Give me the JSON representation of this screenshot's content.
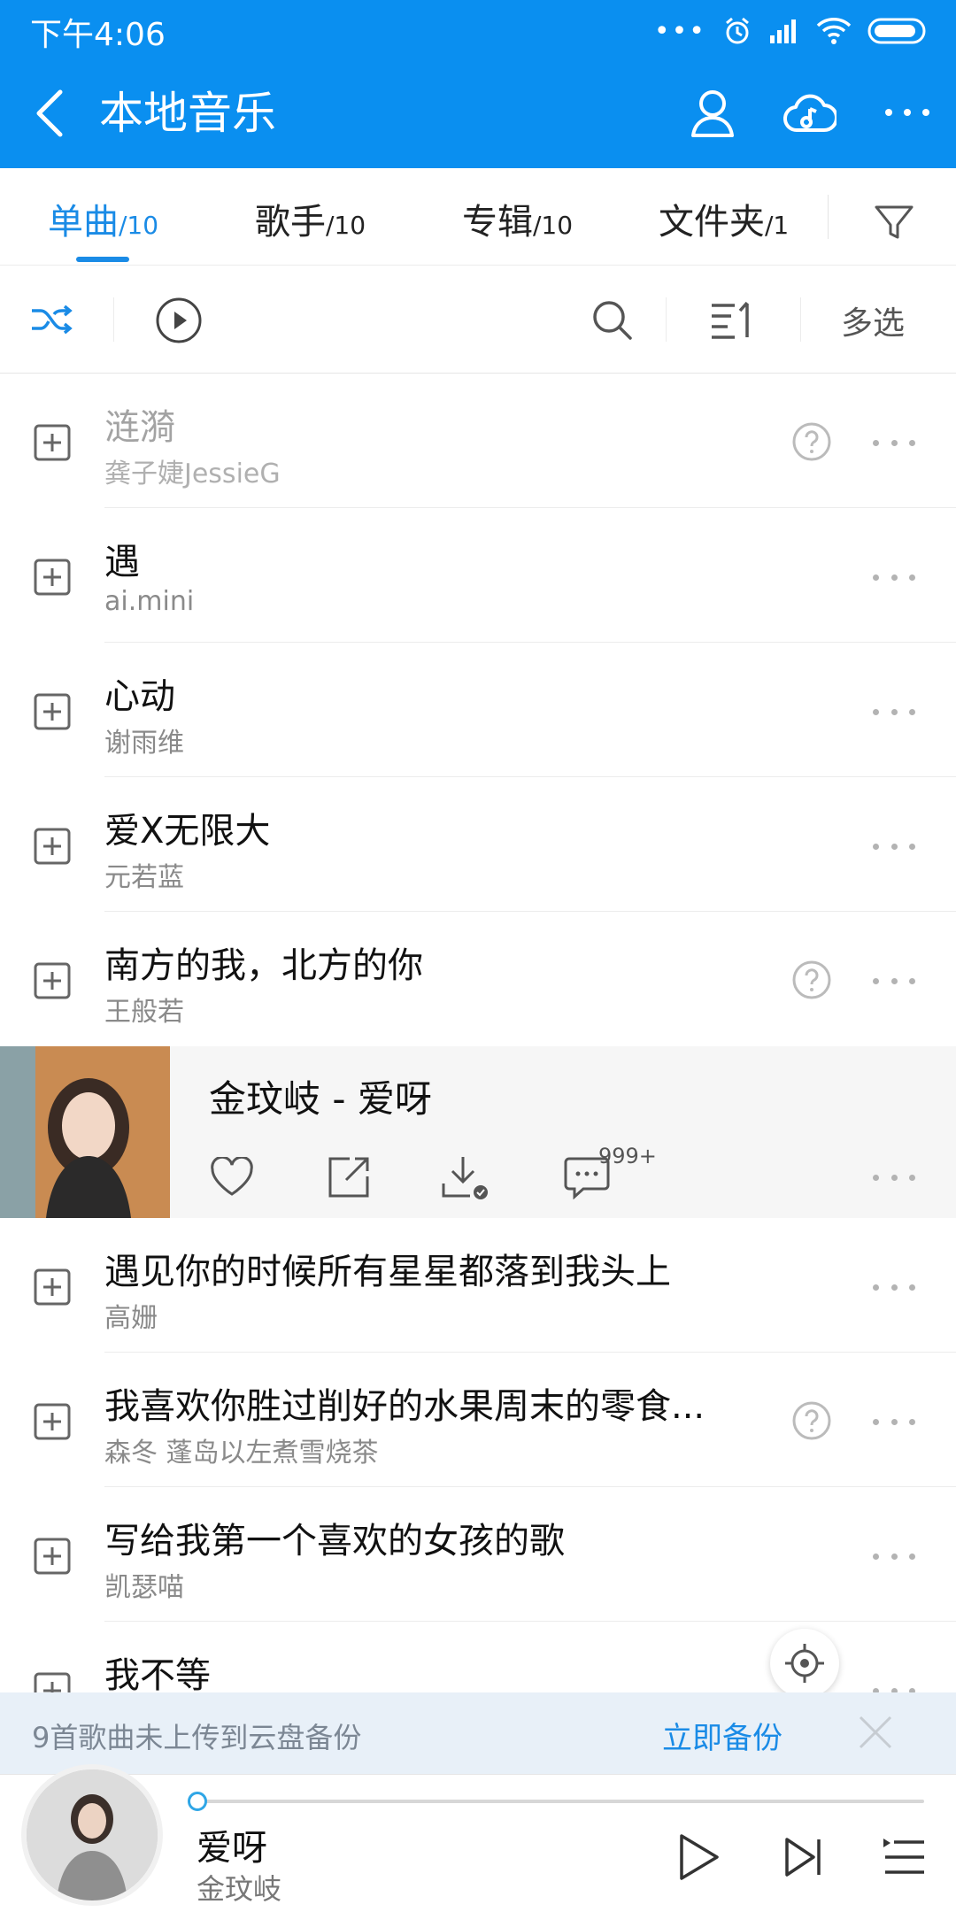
{
  "status_bar": {
    "time": "下午4:06"
  },
  "header": {
    "title": "本地音乐"
  },
  "tabs": [
    {
      "label": "单曲",
      "count": "/10",
      "active": true
    },
    {
      "label": "歌手",
      "count": "/10"
    },
    {
      "label": "专辑",
      "count": "/10"
    },
    {
      "label": "文件夹",
      "count": "/1"
    }
  ],
  "toolbar": {
    "multi_select": "多选"
  },
  "songs": [
    {
      "name": "涟漪",
      "artist": "龚子婕JessieG",
      "unavailable": true,
      "question": true
    },
    {
      "name": "遇",
      "artist": "ai.mini"
    },
    {
      "name": "心动",
      "artist": "谢雨维"
    },
    {
      "name": "爱X无限大",
      "artist": "元若蓝"
    },
    {
      "name": "南方的我，北方的你",
      "artist": "王般若",
      "question": true
    }
  ],
  "expanded_song": {
    "title": "金玟岐 - 爱呀",
    "comment_badge": "999+"
  },
  "songs_after": [
    {
      "name": "遇见你的时候所有星星都落到我头上",
      "artist": "高姗"
    },
    {
      "name": "我喜欢你胜过削好的水果周末的零食...",
      "artist": "森冬 蓬岛以左煮雪烧茶",
      "question": true
    },
    {
      "name": "写给我第一个喜欢的女孩的歌",
      "artist": "凯瑟喵"
    },
    {
      "name": "我不等",
      "artist": ""
    }
  ],
  "backup_bar": {
    "message": "9首歌曲未上传到云盘备份",
    "action": "立即备份"
  },
  "player": {
    "title": "爱呀",
    "artist": "金玟岐",
    "progress": 0.0
  },
  "colors": {
    "accent": "#0a8ff0",
    "link": "#1a8be6"
  }
}
